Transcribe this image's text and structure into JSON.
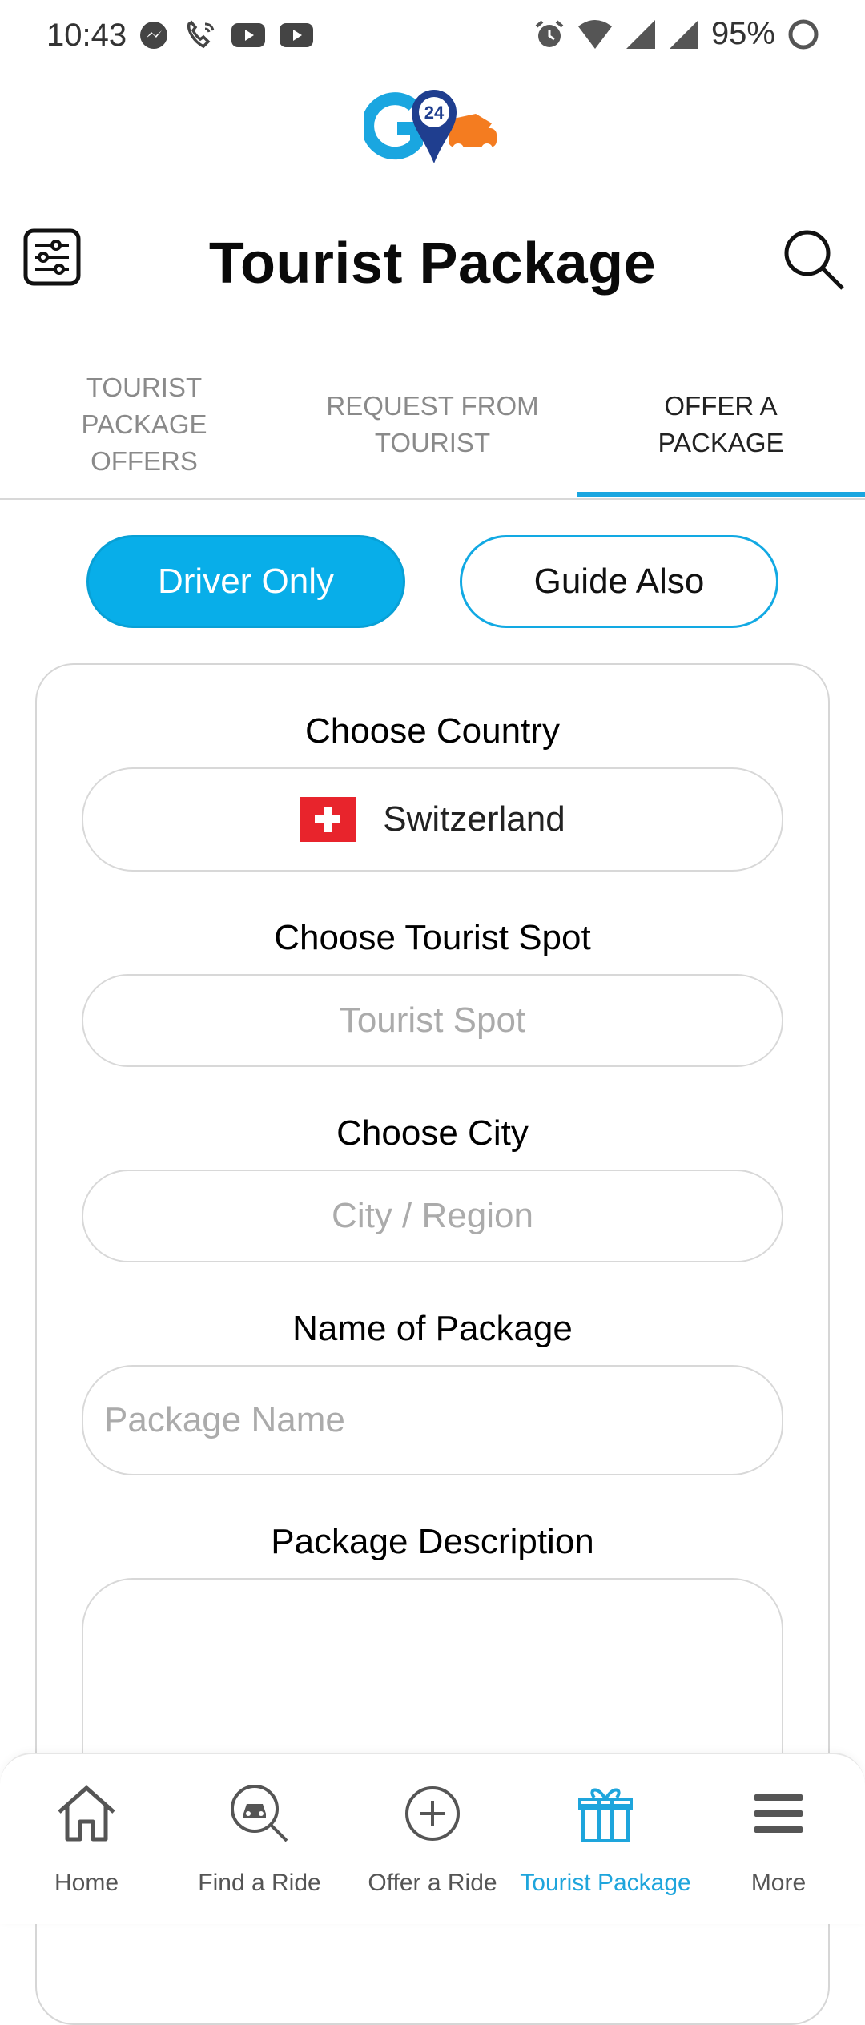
{
  "status_bar": {
    "time": "10:43",
    "battery": "95%",
    "left_icons": [
      "messenger-icon",
      "phone-wifi-icon",
      "youtube-icon",
      "youtube-icon"
    ],
    "right_icons": [
      "alarm-icon",
      "wifi-icon",
      "signal-icon",
      "signal-icon",
      "battery-ring-icon"
    ]
  },
  "logo": {
    "text": "24",
    "colors": {
      "blue": "#1aa6e0",
      "navy": "#1f3e8f",
      "orange": "#f47c20"
    }
  },
  "header": {
    "title": "Tourist Package",
    "menu_icon": "sliders-icon",
    "search_icon": "search-icon"
  },
  "tabs": [
    {
      "label": "TOURIST\nPACKAGE\nOFFERS",
      "active": false
    },
    {
      "label": "REQUEST FROM\nTOURIST",
      "active": false
    },
    {
      "label": "OFFER A\nPACKAGE",
      "active": true
    }
  ],
  "segments": {
    "driver_only": "Driver Only",
    "guide_also": "Guide Also",
    "selected": "driver_only"
  },
  "form": {
    "country_label": "Choose Country",
    "country_value": "Switzerland",
    "tourist_spot_label": "Choose Tourist Spot",
    "tourist_spot_placeholder": "Tourist Spot",
    "city_label": "Choose City",
    "city_placeholder": "City / Region",
    "package_name_label": "Name of Package",
    "package_name_placeholder": "Package Name",
    "description_label": "Package Description",
    "description_value": ""
  },
  "bottom_nav": [
    {
      "label": "Home",
      "icon": "home-icon",
      "active": false
    },
    {
      "label": "Find a Ride",
      "icon": "find-ride-icon",
      "active": false
    },
    {
      "label": "Offer a Ride",
      "icon": "plus-circle-icon",
      "active": false
    },
    {
      "label": "Tourist Package",
      "icon": "gift-icon",
      "active": true
    },
    {
      "label": "More",
      "icon": "menu-icon",
      "active": false
    }
  ],
  "colors": {
    "accent": "#08aee9",
    "border": "#d8d8d8",
    "active_nav": "#1ea5dc"
  }
}
